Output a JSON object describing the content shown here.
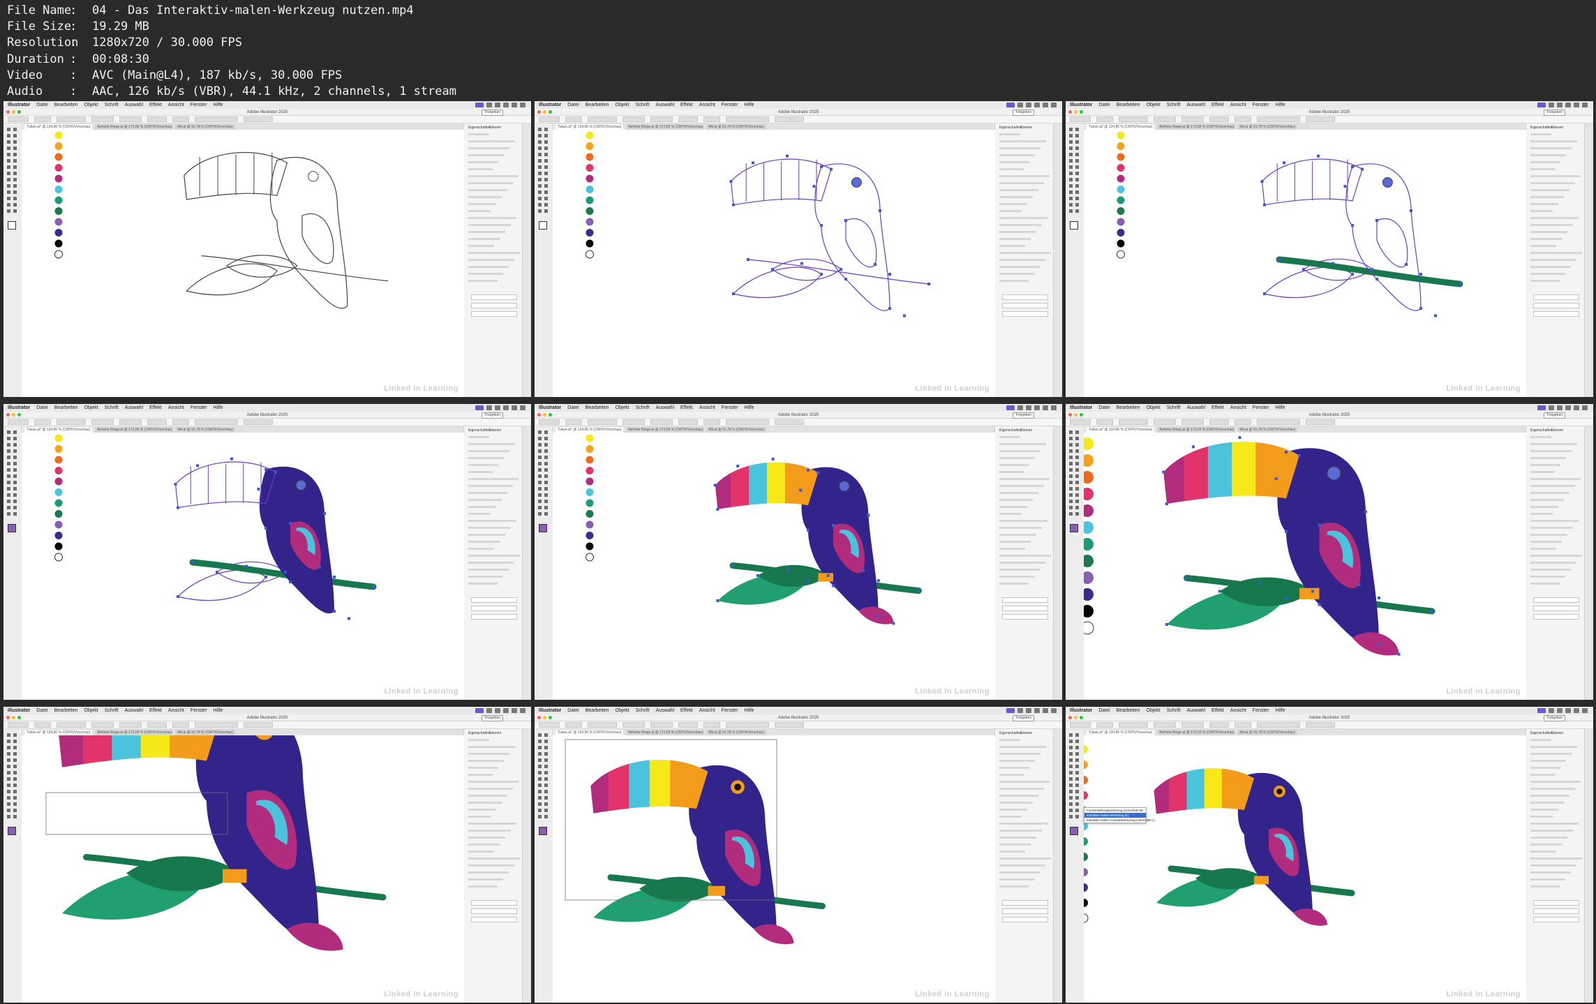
{
  "file_info": [
    {
      "key": "File Name",
      "value": "04 - Das Interaktiv-malen-Werkzeug nutzen.mp4"
    },
    {
      "key": "File Size",
      "value": "19.29 MB"
    },
    {
      "key": "Resolution",
      "value": "1280x720 / 30.000 FPS"
    },
    {
      "key": "Duration",
      "value": "00:08:30"
    },
    {
      "key": "Video",
      "value": "AVC (Main@L4), 187 kb/s, 30.000 FPS"
    },
    {
      "key": "Audio",
      "value": "AAC, 126 kb/s (VBR), 44.1 kHz, 2 channels, 1 stream"
    }
  ],
  "app": {
    "name": "Illustrator",
    "window_title": "Adobe Illustrator 2025",
    "share_label": "Freigeben",
    "menu": [
      "Datei",
      "Bearbeiten",
      "Objekt",
      "Schrift",
      "Auswahl",
      "Effekt",
      "Ansicht",
      "Fenster",
      "Hilfe"
    ],
    "tabs": [
      "Tukan.ai* @ 134,86 % (CMYK/Vorschau)",
      "Befreite Ringe.ai @ 173,59 % (CMYK/Vorschau)",
      "Mit.ai @ 91,78 % (CMYK/Vorschau)"
    ],
    "panel_tabs": [
      "Eigenschaften",
      "Ebenen"
    ],
    "watermark": "Linked in Learning"
  },
  "tooltip_items": [
    "Formerstellungswerkzeug (Umschalt+M)",
    "Interaktiv-malen-Werkzeug (K)",
    "Interaktiv-malen-Auswahlwerkzeug (Umschalt+L)"
  ],
  "colors": {
    "yellow": "#f7e81a",
    "orange_light": "#f6a11b",
    "orange": "#ee6a1c",
    "pink": "#e2336b",
    "magenta": "#b22c7e",
    "cyan": "#4cc3dd",
    "teal": "#1c9b7a",
    "green": "#1a7a4e",
    "violet": "#8a5fb3",
    "indigo": "#3a2b8c",
    "navy": "#2d1f7a",
    "black": "#000000",
    "purple_body": "#33248c",
    "leaf": "#20a06e",
    "leaf_dark": "#17774d",
    "beak_orange": "#f39b1a"
  }
}
